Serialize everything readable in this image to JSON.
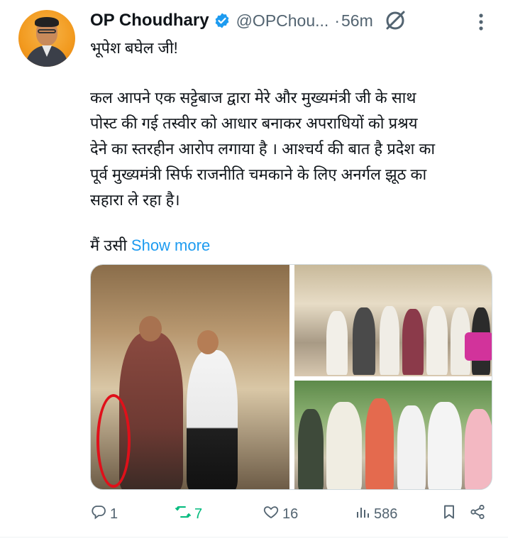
{
  "author": {
    "name": "OP Choudhary",
    "handle": "@OPChou...",
    "time_sep": "·",
    "time": "56m"
  },
  "tweet": {
    "salutation": "भूपेश बघेल जी!",
    "paragraph": [
      "कल आपने एक सट्टेबाज द्वारा मेरे और मुख्यमंत्री जी के साथ",
      "पोस्ट की गई तस्वीर को आधार बनाकर अपराधियों को प्रश्रय",
      "देने का स्तरहीन आरोप लगाया है । आश्चर्य की बात है प्रदेश का",
      "पूर्व मुख्यमंत्री सिर्फ राजनीति चमकाने के लिए अनर्गल झूठ का",
      "सहारा ले रहा है।"
    ],
    "truncated_start": "मैं उसी",
    "show_more": "Show more"
  },
  "stats": {
    "replies": "1",
    "reposts": "7",
    "likes": "16",
    "views": "586"
  },
  "colors": {
    "link": "#1d9bf0",
    "repost_active": "#00ba7c",
    "muted": "#536471",
    "verified": "#1d9bf0",
    "highlight_circle": "#e0101a"
  },
  "icons": {
    "verified": "verified-badge-icon",
    "grok": "grok-icon",
    "more": "more-options-icon",
    "reply": "reply-icon",
    "repost": "repost-icon",
    "like": "like-icon",
    "views": "views-icon",
    "bookmark": "bookmark-icon",
    "share": "share-icon"
  }
}
